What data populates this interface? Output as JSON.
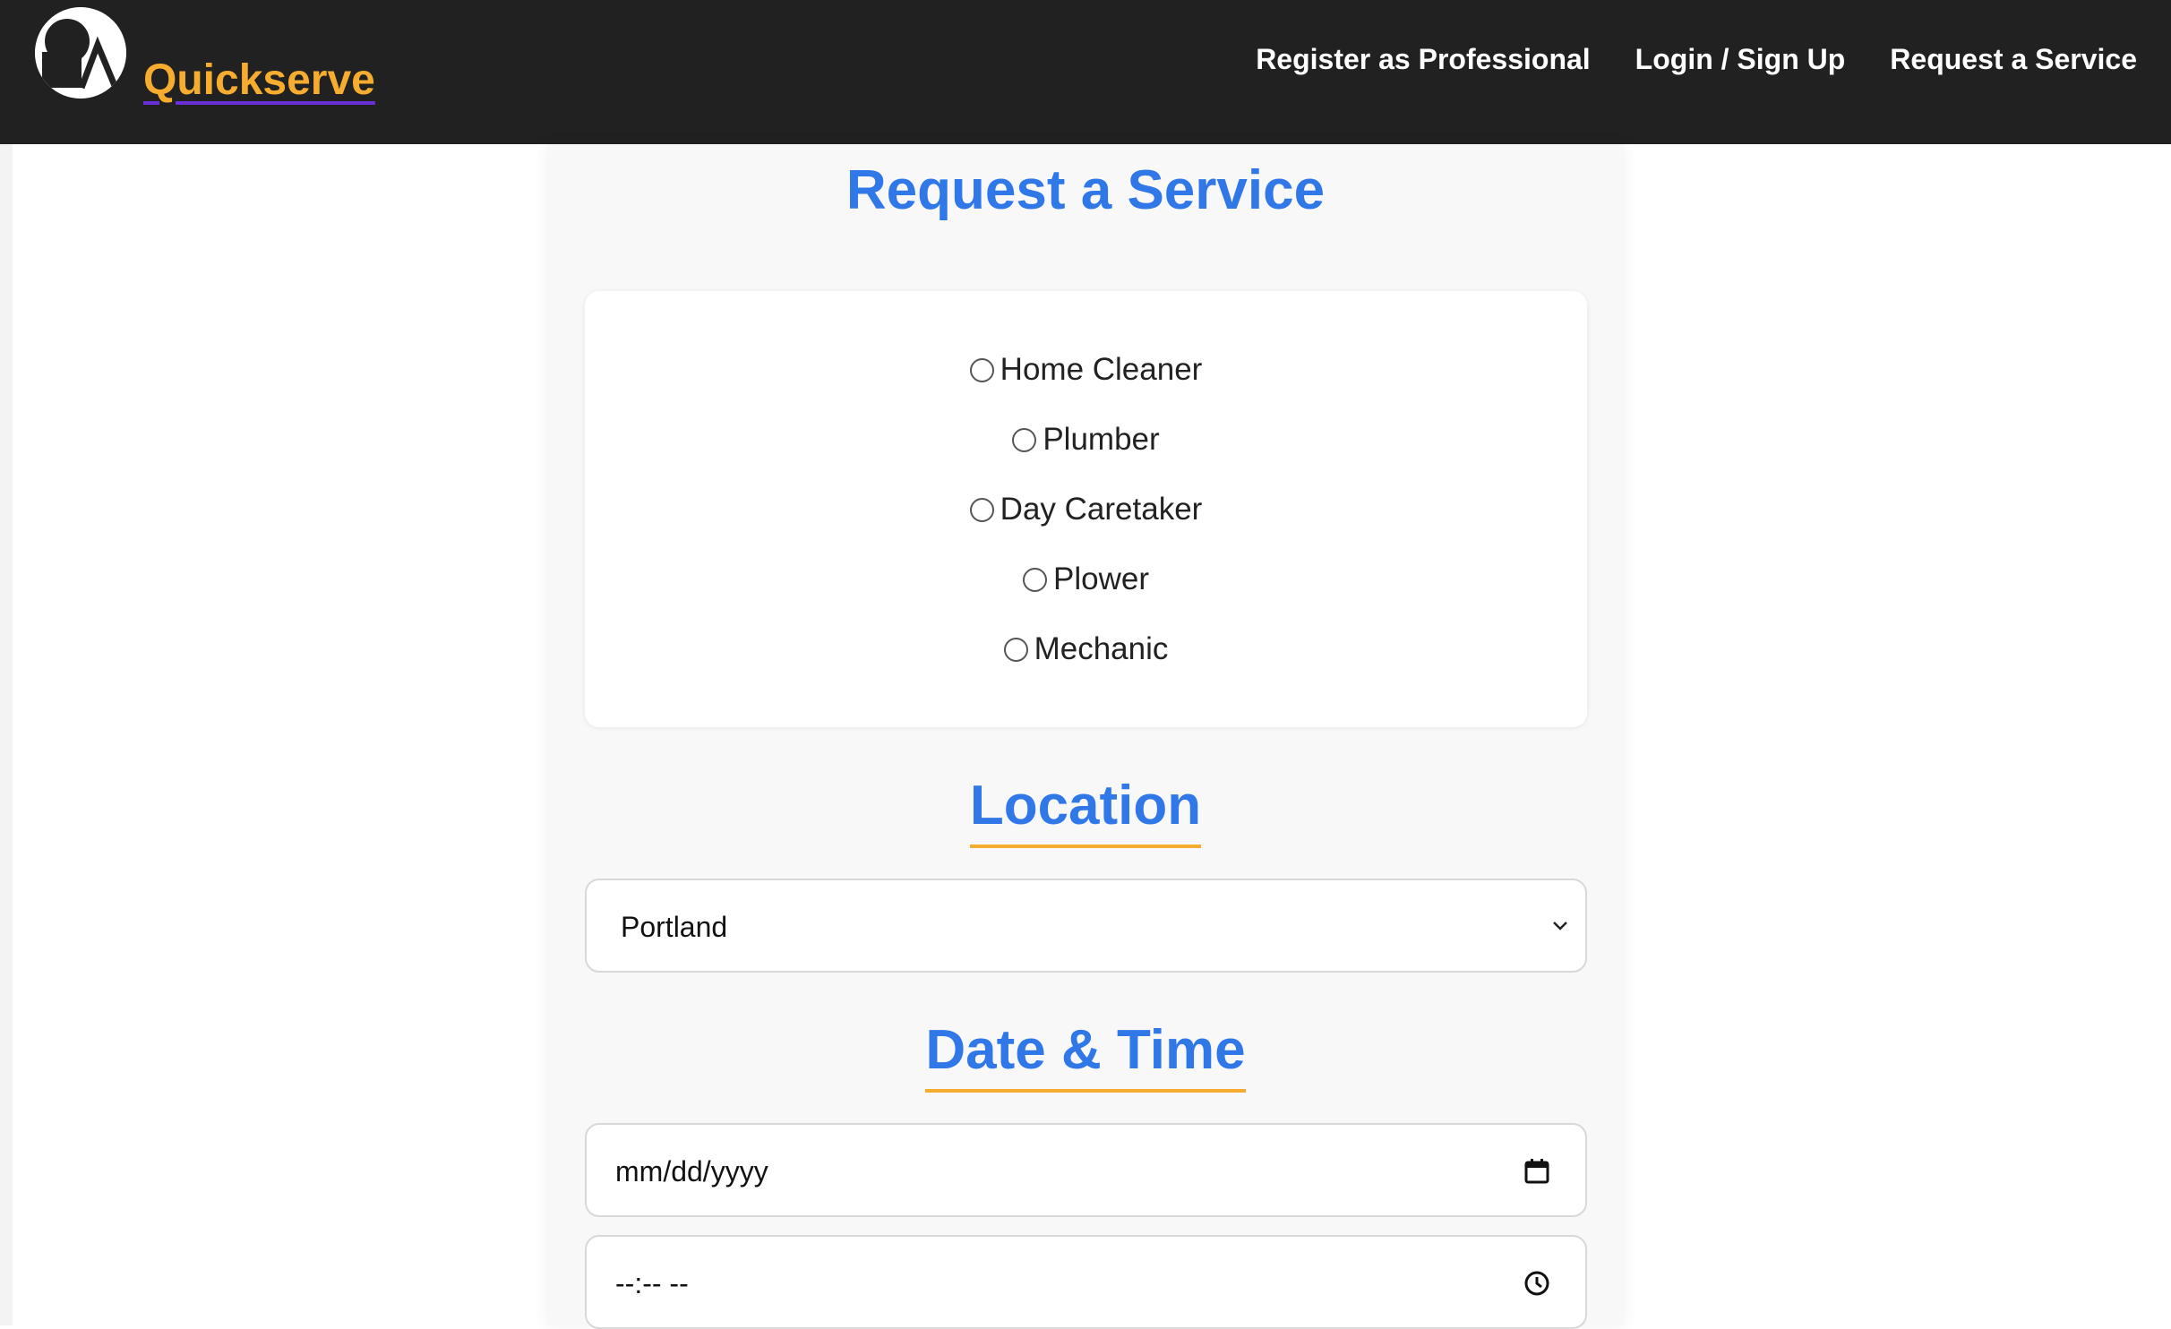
{
  "header": {
    "brand": "Quickserve",
    "nav": [
      "Register as Professional",
      "Login / Sign Up",
      "Request a Service"
    ]
  },
  "main": {
    "title": "Request a Service",
    "services": [
      {
        "label": "Home Cleaner",
        "selected": false
      },
      {
        "label": "Plumber",
        "selected": false
      },
      {
        "label": "Day Caretaker",
        "selected": false
      },
      {
        "label": "Plower",
        "selected": false
      },
      {
        "label": "Mechanic",
        "selected": false
      }
    ],
    "location": {
      "heading": "Location",
      "value": "Portland"
    },
    "datetime": {
      "heading": "Date & Time",
      "date_placeholder": "mm/dd/yyyy",
      "time_placeholder": "--:-- --"
    }
  },
  "colors": {
    "navbar": "#212121",
    "brand": "#f6ad2f",
    "heading": "#3077e8",
    "accent_underline": "#f6ad2f"
  }
}
